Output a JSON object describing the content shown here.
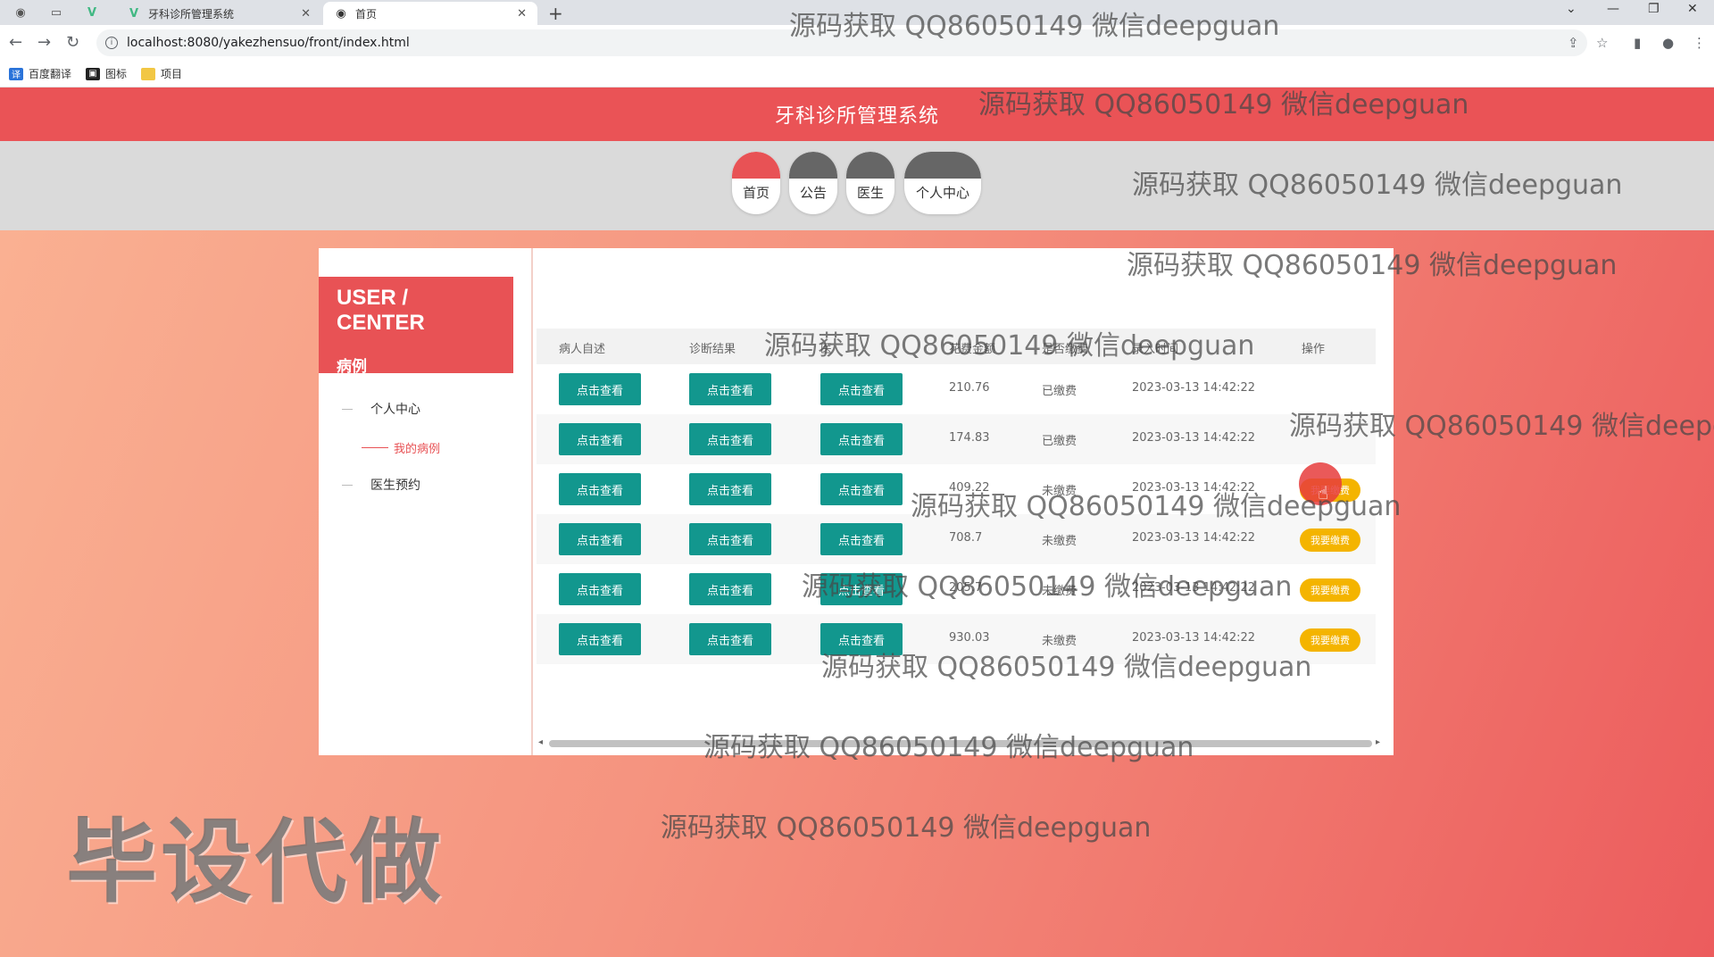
{
  "browser": {
    "tabs": [
      {
        "title": "牙科诊所管理系统",
        "active": false
      },
      {
        "title": "首页",
        "active": true
      }
    ],
    "url": "localhost:8080/yakezhensuo/front/index.html",
    "bookmarks": [
      "百度翻译",
      "图标",
      "项目"
    ]
  },
  "site": {
    "title": "牙科诊所管理系统",
    "nav": [
      "首页",
      "公告",
      "医生",
      "个人中心"
    ],
    "active_nav": "首页"
  },
  "sidebar": {
    "heading": "USER / CENTER",
    "subheading": "病例",
    "menu": [
      "个人中心",
      "我的病例",
      "医生预约"
    ]
  },
  "table": {
    "columns": [
      "病人自述",
      "诊断结果",
      "医",
      "花费金额",
      "是否缴费",
      "录入时间",
      "操作"
    ],
    "view_label": "点击查看",
    "pay_label": "我要缴费",
    "rows": [
      {
        "amount": "210.76",
        "status": "已缴费",
        "time": "2023-03-13 14:42:22",
        "can_pay": false
      },
      {
        "amount": "174.83",
        "status": "已缴费",
        "time": "2023-03-13 14:42:22",
        "can_pay": false
      },
      {
        "amount": "409.22",
        "status": "未缴费",
        "time": "2023-03-13 14:42:22",
        "can_pay": true
      },
      {
        "amount": "708.7",
        "status": "未缴费",
        "time": "2023-03-13 14:42:22",
        "can_pay": true
      },
      {
        "amount": "205.7",
        "status": "未缴费",
        "time": "2023-03-13 14:42:22",
        "can_pay": true
      },
      {
        "amount": "930.03",
        "status": "未缴费",
        "time": "2023-03-13 14:42:22",
        "can_pay": true
      }
    ]
  },
  "overlay": {
    "watermark": "源码获取 QQ86050149 微信deepguan",
    "big_text": "毕设代做"
  },
  "colors": {
    "brand": "#ea5356",
    "teal": "#12978e",
    "pay": "#f4b400"
  }
}
